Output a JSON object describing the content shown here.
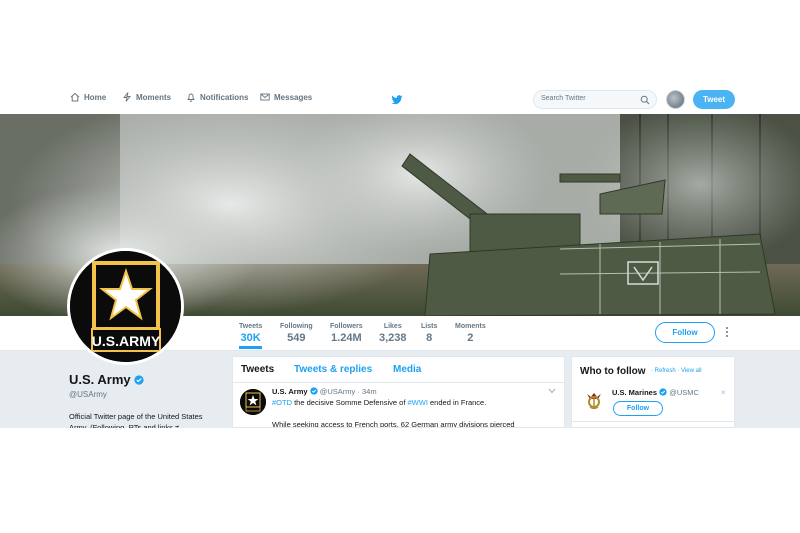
{
  "nav": {
    "home": "Home",
    "moments": "Moments",
    "notifications": "Notifications",
    "messages": "Messages",
    "search_placeholder": "Search Twitter",
    "tweet_button": "Tweet"
  },
  "profile": {
    "name": "U.S. Army",
    "handle": "@USArmy",
    "bio": "Official Twitter page of the United States Army. (Following, RTs and links ≠",
    "logo_text": "U.S.ARMY"
  },
  "stats": [
    {
      "label": "Tweets",
      "value": "30K"
    },
    {
      "label": "Following",
      "value": "549"
    },
    {
      "label": "Followers",
      "value": "1.24M"
    },
    {
      "label": "Likes",
      "value": "3,238"
    },
    {
      "label": "Lists",
      "value": "8"
    },
    {
      "label": "Moments",
      "value": "2"
    }
  ],
  "follow_button": "Follow",
  "timeline": {
    "tabs": [
      "Tweets",
      "Tweets & replies",
      "Media"
    ],
    "tweet": {
      "name": "U.S. Army",
      "handle": "@USArmy",
      "time": "· 34m",
      "hashtag1": "#OTD",
      "text1": " the decisive Somme Defensive of ",
      "hashtag2": "#WWI",
      "text2": " ended in France.",
      "line2": "While seeking access to French ports, 62 German army divisions pierced"
    }
  },
  "who_to_follow": {
    "title": "Who to follow",
    "refresh": "Refresh",
    "view_all": "View all",
    "separator": "·",
    "account_name": "U.S. Marines",
    "account_handle": "@USMC",
    "follow": "Follow",
    "close": "×"
  },
  "colors": {
    "accent": "#1da1f2",
    "tweet_button": "#4ab3f4",
    "logo_gold": "#f2c24a",
    "logo_black": "#0b0b0b"
  }
}
